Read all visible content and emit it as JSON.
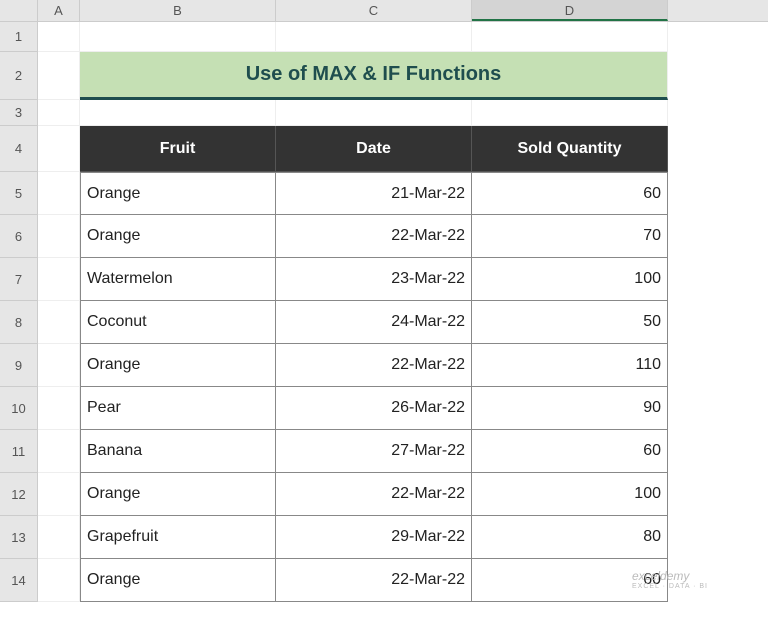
{
  "columns": [
    "A",
    "B",
    "C",
    "D"
  ],
  "selected_column": "D",
  "row_numbers": [
    1,
    2,
    3,
    4,
    5,
    6,
    7,
    8,
    9,
    10,
    11,
    12,
    13,
    14
  ],
  "title": "Use of MAX & IF Functions",
  "headers": {
    "fruit": "Fruit",
    "date": "Date",
    "qty": "Sold Quantity"
  },
  "rows": [
    {
      "fruit": "Orange",
      "date": "21-Mar-22",
      "qty": "60"
    },
    {
      "fruit": "Orange",
      "date": "22-Mar-22",
      "qty": "70"
    },
    {
      "fruit": "Watermelon",
      "date": "23-Mar-22",
      "qty": "100"
    },
    {
      "fruit": "Coconut",
      "date": "24-Mar-22",
      "qty": "50"
    },
    {
      "fruit": "Orange",
      "date": "22-Mar-22",
      "qty": "110"
    },
    {
      "fruit": "Pear",
      "date": "26-Mar-22",
      "qty": "90"
    },
    {
      "fruit": "Banana",
      "date": "27-Mar-22",
      "qty": "60"
    },
    {
      "fruit": "Orange",
      "date": "22-Mar-22",
      "qty": "100"
    },
    {
      "fruit": "Grapefruit",
      "date": "29-Mar-22",
      "qty": "80"
    },
    {
      "fruit": "Orange",
      "date": "22-Mar-22",
      "qty": "60"
    }
  ],
  "row_heights": {
    "r1": 30,
    "r2": 48,
    "r3": 26,
    "r4": 46,
    "data": 43
  },
  "watermark": {
    "main": "exceldemy",
    "sub": "EXCEL · DATA · BI"
  },
  "chart_data": {
    "type": "table",
    "title": "Use of MAX & IF Functions",
    "columns": [
      "Fruit",
      "Date",
      "Sold Quantity"
    ],
    "data": [
      [
        "Orange",
        "21-Mar-22",
        60
      ],
      [
        "Orange",
        "22-Mar-22",
        70
      ],
      [
        "Watermelon",
        "23-Mar-22",
        100
      ],
      [
        "Coconut",
        "24-Mar-22",
        50
      ],
      [
        "Orange",
        "22-Mar-22",
        110
      ],
      [
        "Pear",
        "26-Mar-22",
        90
      ],
      [
        "Banana",
        "27-Mar-22",
        60
      ],
      [
        "Orange",
        "22-Mar-22",
        100
      ],
      [
        "Grapefruit",
        "29-Mar-22",
        80
      ],
      [
        "Orange",
        "22-Mar-22",
        60
      ]
    ]
  }
}
